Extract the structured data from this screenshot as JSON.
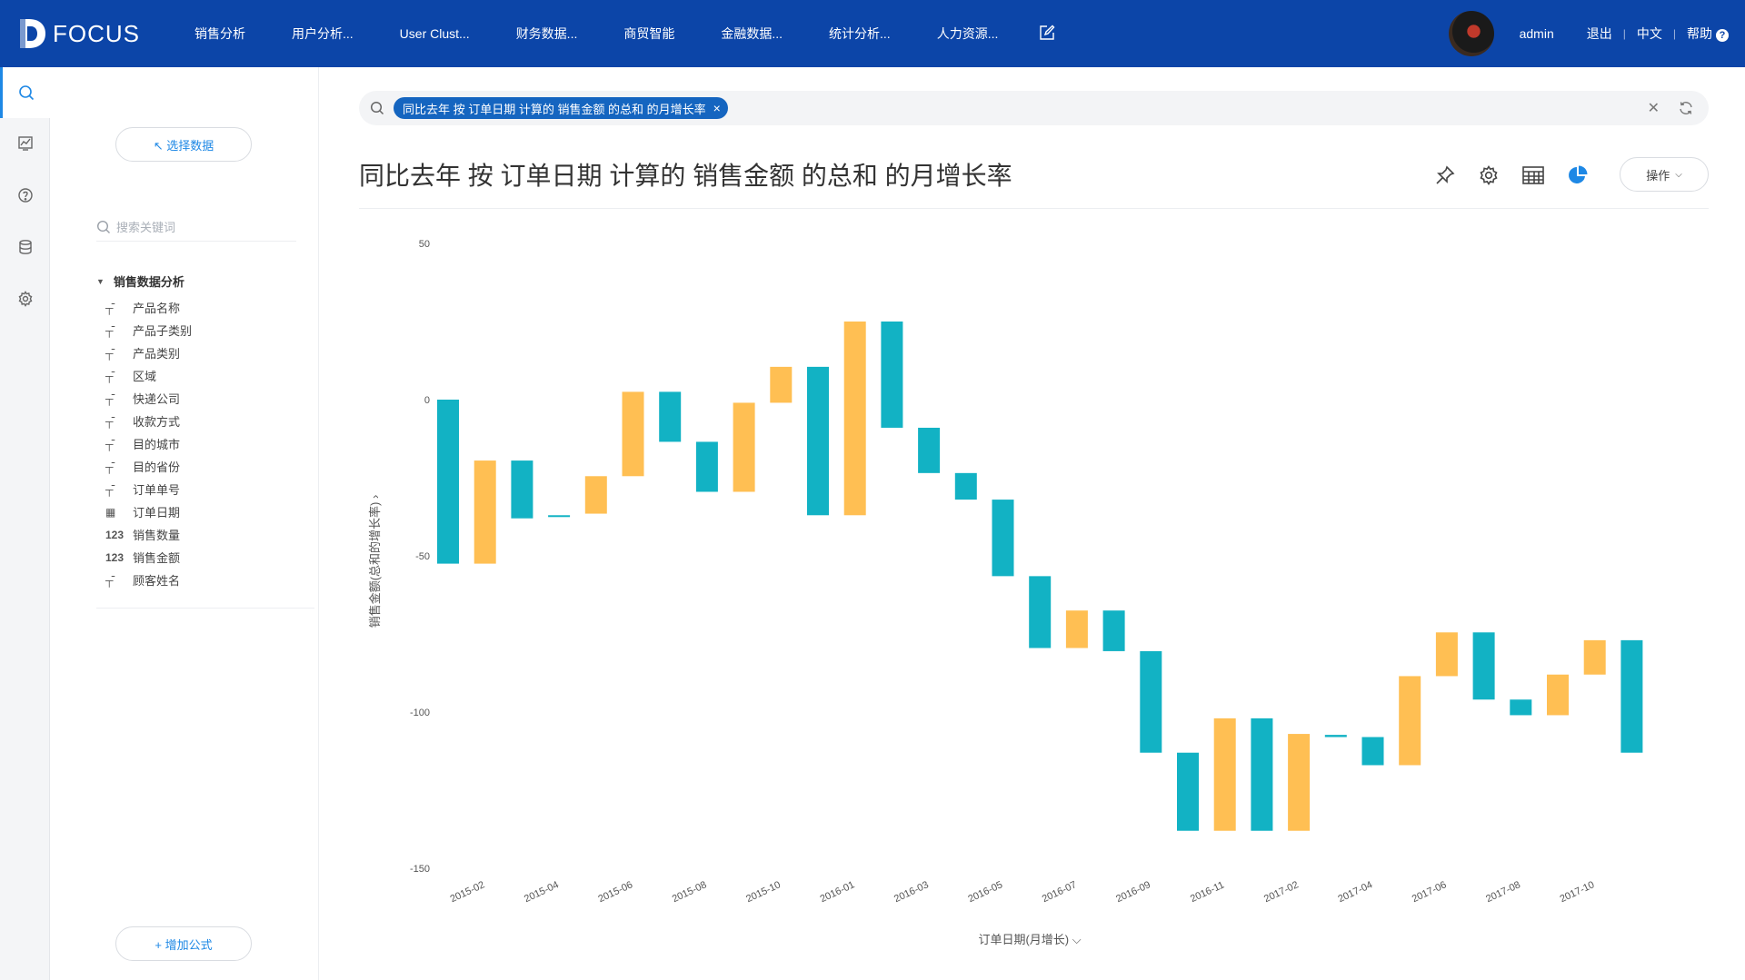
{
  "app": {
    "logo_text": "FOCUS"
  },
  "nav": {
    "items": [
      "销售分析",
      "用户分析...",
      "User Clust...",
      "财务数据...",
      "商贸智能",
      "金融数据...",
      "统计分析...",
      "人力资源..."
    ]
  },
  "user": {
    "name": "admin",
    "logout": "退出",
    "lang": "中文",
    "help": "帮助",
    "help_mark": "?"
  },
  "left": {
    "select_data": "↖ 选择数据",
    "search_placeholder": "搜索关键词",
    "tree_title": "销售数据分析",
    "fields": [
      {
        "type": "text",
        "label": "产品名称"
      },
      {
        "type": "text",
        "label": "产品子类别"
      },
      {
        "type": "text",
        "label": "产品类别"
      },
      {
        "type": "text",
        "label": "区域"
      },
      {
        "type": "text",
        "label": "快递公司"
      },
      {
        "type": "text",
        "label": "收款方式"
      },
      {
        "type": "text",
        "label": "目的城市"
      },
      {
        "type": "text",
        "label": "目的省份"
      },
      {
        "type": "text",
        "label": "订单单号"
      },
      {
        "type": "date",
        "label": "订单日期"
      },
      {
        "type": "num",
        "label": "销售数量",
        "type_label": "123"
      },
      {
        "type": "num",
        "label": "销售金额",
        "type_label": "123"
      },
      {
        "type": "text",
        "label": "顾客姓名"
      }
    ],
    "add_formula": "+ 增加公式"
  },
  "search": {
    "chip": "同比去年 按 订单日期 计算的 销售金额 的总和 的月增长率"
  },
  "page": {
    "title": "同比去年 按 订单日期 计算的 销售金额 的总和 的月增长率",
    "ops": "操作"
  },
  "chart_data": {
    "type": "bar",
    "subtype": "waterfall",
    "xlabel": "订单日期(月增长)",
    "ylabel": "销售金额(总和的增长率)",
    "ylim": [
      -150,
      50
    ],
    "yticks": [
      50,
      0,
      -50,
      -100,
      -150
    ],
    "tick_labels": [
      "2015-02",
      "2015-04",
      "2015-06",
      "2015-08",
      "2015-10",
      "2016-01",
      "2016-03",
      "2016-05",
      "2016-07",
      "2016-09",
      "2016-11",
      "2017-02",
      "2017-04",
      "2017-06",
      "2017-08",
      "2017-10"
    ],
    "colors": {
      "decrease": "#12b2c4",
      "increase": "#ffbf53"
    },
    "bars": [
      {
        "start": 0,
        "end": -52.5
      },
      {
        "start": -52.5,
        "end": -19.5
      },
      {
        "start": -19.5,
        "end": -38
      },
      {
        "start": -37,
        "end": -37.5
      },
      {
        "start": -36.5,
        "end": -24.5
      },
      {
        "start": -24.5,
        "end": 2.5
      },
      {
        "start": 2.5,
        "end": -13.5
      },
      {
        "start": -13.5,
        "end": -29.5
      },
      {
        "start": -29.5,
        "end": -1
      },
      {
        "start": -1,
        "end": 10.5
      },
      {
        "start": 10.5,
        "end": -37
      },
      {
        "start": -37,
        "end": 25
      },
      {
        "start": 25,
        "end": -9
      },
      {
        "start": -9,
        "end": -23.5
      },
      {
        "start": -23.5,
        "end": -32
      },
      {
        "start": -32,
        "end": -56.5
      },
      {
        "start": -56.5,
        "end": -79.5
      },
      {
        "start": -79.5,
        "end": -67.5
      },
      {
        "start": -67.5,
        "end": -80.5
      },
      {
        "start": -80.5,
        "end": -113
      },
      {
        "start": -113,
        "end": -138
      },
      {
        "start": -138,
        "end": -102
      },
      {
        "start": -102,
        "end": -138
      },
      {
        "start": -138,
        "end": -107
      },
      {
        "start": -107.3,
        "end": -108
      },
      {
        "start": -108,
        "end": -117
      },
      {
        "start": -117,
        "end": -88.5
      },
      {
        "start": -88.5,
        "end": -74.5
      },
      {
        "start": -74.5,
        "end": -96
      },
      {
        "start": -96,
        "end": -101
      },
      {
        "start": -101,
        "end": -88
      },
      {
        "start": -88,
        "end": -77
      },
      {
        "start": -77,
        "end": -113
      }
    ]
  }
}
